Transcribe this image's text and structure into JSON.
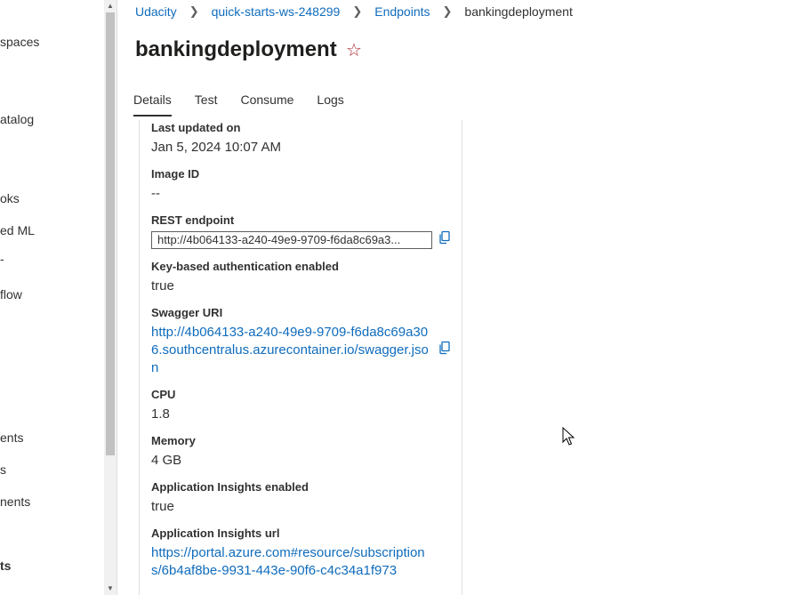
{
  "left_nav": {
    "items": [
      {
        "label": "spaces",
        "bold": false
      },
      {
        "label": "atalog",
        "bold": false
      },
      {
        "label": "oks",
        "bold": false
      },
      {
        "label": "ed ML",
        "bold": false
      },
      {
        "label": "-",
        "bold": false
      },
      {
        "label": "flow",
        "bold": false
      },
      {
        "label": "ents",
        "bold": false
      },
      {
        "label": "s",
        "bold": false
      },
      {
        "label": "nents",
        "bold": false
      },
      {
        "label": "ts",
        "bold": true
      }
    ]
  },
  "breadcrumb": {
    "items": [
      "Udacity",
      "quick-starts-ws-248299",
      "Endpoints"
    ],
    "current": "bankingdeployment",
    "separator": ">"
  },
  "page": {
    "title": "bankingdeployment",
    "star_icon": "☆"
  },
  "tabs": [
    {
      "label": "Details",
      "active": true
    },
    {
      "label": "Test",
      "active": false
    },
    {
      "label": "Consume",
      "active": false
    },
    {
      "label": "Logs",
      "active": false
    }
  ],
  "details": {
    "last_updated": {
      "label": "Last updated on",
      "value": "Jan 5, 2024 10:07 AM"
    },
    "image_id": {
      "label": "Image ID",
      "value": "--"
    },
    "rest_endpoint": {
      "label": "REST endpoint",
      "value": "http://4b064133-a240-49e9-9709-f6da8c69a3..."
    },
    "key_auth": {
      "label": "Key-based authentication enabled",
      "value": "true"
    },
    "swagger": {
      "label": "Swagger URI",
      "value": "http://4b064133-a240-49e9-9709-f6da8c69a306.southcentralus.azurecontainer.io/swagger.json"
    },
    "cpu": {
      "label": "CPU",
      "value": "1.8"
    },
    "memory": {
      "label": "Memory",
      "value": "4 GB"
    },
    "app_insights": {
      "label": "Application Insights enabled",
      "value": "true"
    },
    "app_insights_url": {
      "label": "Application Insights url",
      "value": "https://portal.azure.com#resource/subscriptions/6b4af8be-9931-443e-90f6-c4c34a1f973"
    }
  },
  "colors": {
    "link": "#0f6cbd",
    "star": "#a4262c",
    "text": "#323130"
  }
}
